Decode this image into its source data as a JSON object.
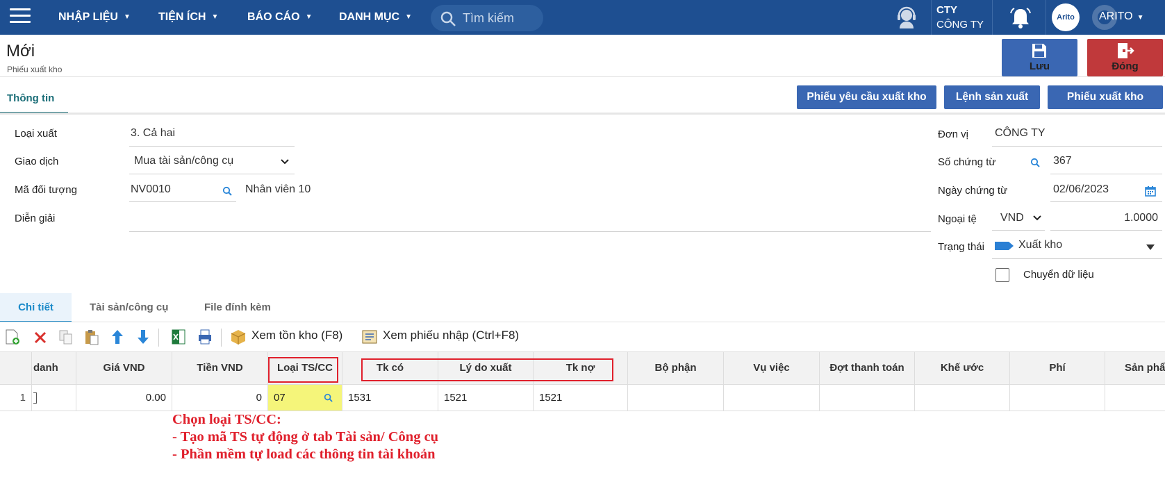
{
  "nav": {
    "menus": [
      {
        "label": "NHẬP LIỆU"
      },
      {
        "label": "TIỆN ÍCH"
      },
      {
        "label": "BÁO CÁO"
      },
      {
        "label": "DANH MỤC"
      }
    ],
    "search_placeholder": "Tìm kiếm",
    "company_code": "CTY",
    "company_name": "CÔNG TY",
    "avatar_text": "Arito",
    "user": "ARITO"
  },
  "header": {
    "title": "Mới",
    "subtitle": "Phiếu xuất kho",
    "save_label": "Lưu",
    "close_label": "Đóng"
  },
  "tabs": {
    "info": "Thông tin"
  },
  "actions": [
    "Phiếu yêu cầu xuất kho",
    "Lệnh sản xuất",
    "Phiếu xuất kho"
  ],
  "form": {
    "loai_xuat": {
      "label": "Loại xuất",
      "value": "3. Cả hai"
    },
    "giao_dich": {
      "label": "Giao dịch",
      "value": "Mua tài sản/công cụ"
    },
    "ma_doi_tuong": {
      "label": "Mã đối tượng",
      "value": "NV0010",
      "name": "Nhân viên 10"
    },
    "dien_giai": {
      "label": "Diễn giải",
      "value": ""
    },
    "don_vi": {
      "label": "Đơn vị",
      "value": "CÔNG TY"
    },
    "so_chung_tu": {
      "label": "Số chứng từ",
      "value": "367"
    },
    "ngay_chung_tu": {
      "label": "Ngày chứng từ",
      "value": "02/06/2023"
    },
    "ngoai_te": {
      "label": "Ngoại tệ",
      "currency": "VND",
      "rate": "1.0000"
    },
    "trang_thai": {
      "label": "Trạng thái",
      "value": "Xuất kho"
    },
    "chuyen_du_lieu": {
      "label": "Chuyển dữ liệu",
      "checked": false
    }
  },
  "subtabs": [
    "Chi tiết",
    "Tài sản/công cụ",
    "File đính kèm"
  ],
  "toolbar": {
    "xem_ton_kho": "Xem tồn kho (F8)",
    "xem_phieu_nhap": "Xem phiếu nhập (Ctrl+F8)"
  },
  "grid": {
    "columns": [
      "danh",
      "Giá VND",
      "Tiền VND",
      "Loại TS/CC",
      "Tk có",
      "Lý do xuất",
      "Tk nợ",
      "Bộ phận",
      "Vụ việc",
      "Đợt thanh toán",
      "Khế ước",
      "Phí",
      "Sản phẩ"
    ],
    "rows": [
      {
        "no": "1",
        "gia": "0.00",
        "tien": "0",
        "loai": "07",
        "tk_co": "1531",
        "ly_do": "1521",
        "tk_no": "1521"
      }
    ]
  },
  "annotation": {
    "line1": "Chọn loại TS/CC:",
    "line2": "- Tạo mã TS tự động ở tab Tài sản/ Công cụ",
    "line3": "- Phần mềm tự load các thông tin tài khoản"
  }
}
